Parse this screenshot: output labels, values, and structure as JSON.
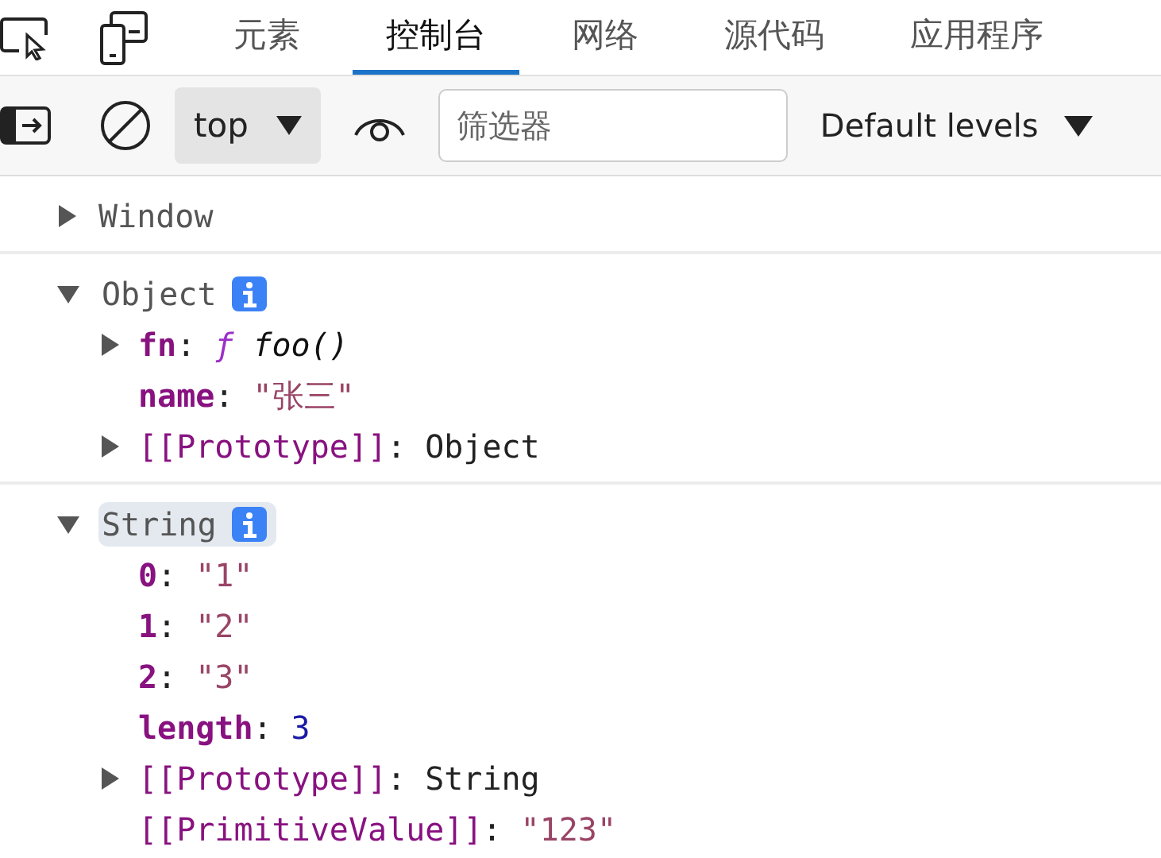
{
  "tabs": [
    {
      "label": "元素",
      "selected": false
    },
    {
      "label": "控制台",
      "selected": true
    },
    {
      "label": "网络",
      "selected": false
    },
    {
      "label": "源代码",
      "selected": false
    },
    {
      "label": "应用程序",
      "selected": false
    }
  ],
  "toolbar": {
    "context": "top",
    "filter": {
      "placeholder": "筛选器"
    },
    "levels": "Default levels"
  },
  "messages": [
    {
      "label": "Window",
      "expanded": false,
      "info": false,
      "highlighted": false
    },
    {
      "label": "Object",
      "expanded": true,
      "info": true,
      "highlighted": false,
      "properties": [
        {
          "key": "fn",
          "separator": ":",
          "internal": false,
          "expandable": true,
          "kind": "function",
          "prefix": "ƒ",
          "value": "foo()"
        },
        {
          "key": "name",
          "separator": ":",
          "internal": false,
          "expandable": false,
          "kind": "string",
          "value": "\"张三\""
        },
        {
          "key": "[[Prototype]]",
          "separator": ":",
          "internal": true,
          "expandable": true,
          "kind": "object",
          "value": "Object"
        }
      ]
    },
    {
      "label": "String",
      "expanded": true,
      "info": true,
      "highlighted": true,
      "properties": [
        {
          "key": "0",
          "separator": ":",
          "internal": false,
          "expandable": false,
          "kind": "string",
          "value": "\"1\""
        },
        {
          "key": "1",
          "separator": ":",
          "internal": false,
          "expandable": false,
          "kind": "string",
          "value": "\"2\""
        },
        {
          "key": "2",
          "separator": ":",
          "internal": false,
          "expandable": false,
          "kind": "string",
          "value": "\"3\""
        },
        {
          "key": "length",
          "separator": ":",
          "internal": false,
          "expandable": false,
          "kind": "number",
          "value": "3"
        },
        {
          "key": "[[Prototype]]",
          "separator": ":",
          "internal": true,
          "expandable": true,
          "kind": "object",
          "value": "String"
        },
        {
          "key": "[[PrimitiveValue]]",
          "separator": ":",
          "internal": true,
          "expandable": false,
          "kind": "string",
          "value": "\"123\""
        }
      ]
    }
  ]
}
